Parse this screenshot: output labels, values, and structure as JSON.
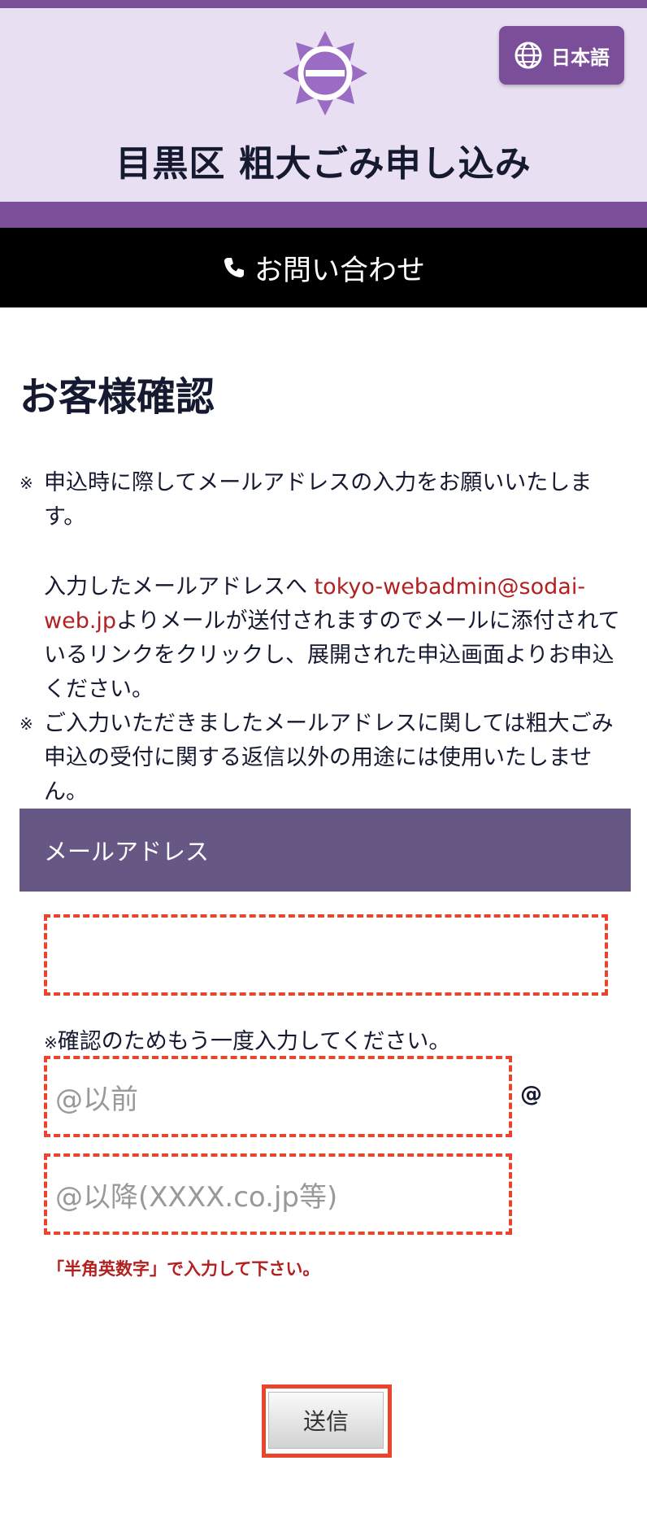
{
  "header": {
    "title": "目黒区 粗大ごみ申し込み",
    "language_button": "日本語",
    "emblem_icon": "meguro-emblem-icon",
    "accent_color": "#7a4e98"
  },
  "contact_bar": {
    "label": "お問い合わせ",
    "icon": "phone-icon"
  },
  "page": {
    "title": "お客様確認"
  },
  "notices": {
    "mark": "※",
    "n1": "申込時に際してメールアドレスの入力をお願いいたします。",
    "n2_prefix": "入力したメールアドレスへ ",
    "n2_email": "tokyo-webadmin@sodai-web.jp",
    "n2_suffix": "よりメールが送付されますのでメールに添付されているリンクをクリックし、展開された申込画面よりお申込ください。",
    "n3": "ご入力いただきましたメールアドレスに関しては粗大ごみ申込の受付に関する返信以外の用途には使用いたしません。"
  },
  "form": {
    "section_label": "メールアドレス",
    "email_value": "",
    "confirm_note": "確認のためもう一度入力してください。",
    "confirm_before_placeholder": "@以前",
    "at_sign": "@",
    "confirm_after_placeholder": "@以降(XXXX.co.jp等)",
    "hint": "「半角英数字」で入力して下さい。",
    "submit_label": "送信"
  }
}
